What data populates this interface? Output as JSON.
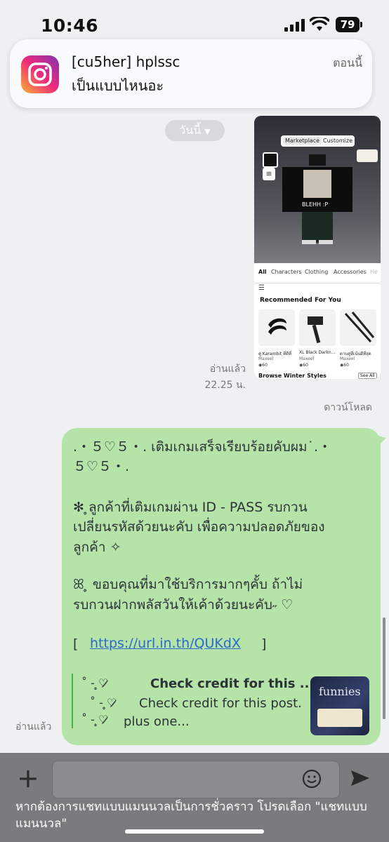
{
  "status_bar": {
    "time": "10:46",
    "battery": "79"
  },
  "notification": {
    "app_icon": "instagram-icon",
    "title": "[cu5her] hplssc",
    "body": "เป็นแบบไหนอะ",
    "time": "ตอนนี้"
  },
  "chat": {
    "date_pill": "วันนี้",
    "image_message": {
      "tabs": [
        "Marketplace",
        "Customize"
      ],
      "avatar_text": "BLEHH :P",
      "categories": [
        "All",
        "Characters",
        "Clothing",
        "Accessories",
        "He"
      ],
      "section_title": "Recommended For You",
      "items": [
        {
          "name": "คู่ Karambit ที่ดีที่",
          "seller": "Maxeel",
          "price": "60"
        },
        {
          "name": "XL Black Darkn...",
          "seller": "Maxeel",
          "price": "60"
        },
        {
          "name": "ดาบคู่ที่เน้นดีที่สุด",
          "seller": "Maxeel",
          "price": "60"
        }
      ],
      "footer_text": "Browse Winter Styles",
      "see_all": "See All",
      "read_label": "อ่านแล้ว",
      "time": "22.25 น.",
      "download_label": "ดาวน์โหลด"
    },
    "text_message": {
      "line1": ".・５♡５・. เติมเกมเสร็จเรียบร้อยคับผม˙.・",
      "line2": "５♡５・.",
      "line3": "  ✻  ̥ลูกค้าที่เติมเกมผ่าน ID -  PASS รบกวน",
      "line4": "เปลี่ยนรหัสด้วยนะคับ เพื่อความปลอดภัยของ",
      "line5": "ลูกค้า  ✧",
      "line6": "ꕤ  ̥ ขอบคุณที่มาใช้บริการมากๆคั้บ ถ้าไม่",
      "line7": "รบกวนฝากพลัสวันให้เค้าด้วยนะคับ˶ ♡",
      "link_open": "[",
      "link": "https://url.in.th/QUKdX",
      "link_close": "]",
      "quote_title": "Check credit for this ...",
      "quote_body": "Check credit for this post.",
      "quote_body2": "plus one...",
      "quote_symbol": "˚ - ̥♡̷̷",
      "quote_thumb_text": "funnies",
      "read_label": "อ่านแล้ว"
    }
  },
  "composer": {
    "banner": "หากต้องการแชทแบบแมนนวลเป็นการชั่วคราว โปรดเลือก \"แชทแบบแมนนวล\""
  }
}
